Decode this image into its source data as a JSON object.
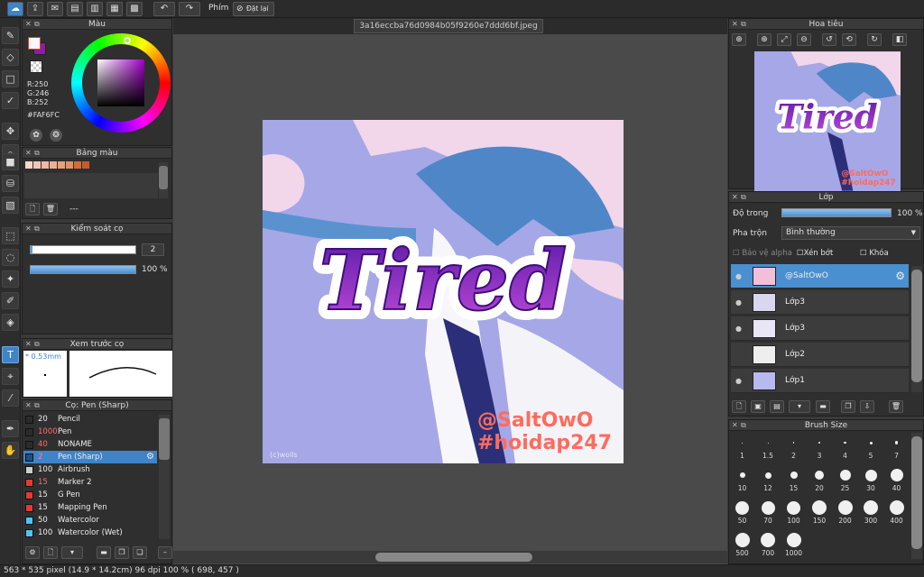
{
  "toolbar": {
    "shortcut_label": "Phím",
    "reset_label": "Đặt lại"
  },
  "document": {
    "tab_title": "3a16eccba76d0984b05f9260e7ddd6bf.jpeg"
  },
  "color_panel": {
    "title": "Màu",
    "r": "R:250",
    "g": "G:246",
    "b": "B:252",
    "hex": "#FAF6FC",
    "main_color": "#fff6fc",
    "sub_color": "#8b1fa0"
  },
  "palette_panel": {
    "title": "Bảng màu",
    "swatches": [
      "#f6d7c8",
      "#f2c7b2",
      "#efb9a2",
      "#f0b091",
      "#e9a07c",
      "#e58f66",
      "#d66a3a",
      "#c95a2e"
    ],
    "name": "---"
  },
  "brush_control": {
    "title": "Kiểm soát cọ",
    "size_value": "2",
    "opacity_value": "100 %",
    "size_fraction": 0.02,
    "opacity_fraction": 1.0
  },
  "brush_preview": {
    "title": "Xem trước cọ",
    "size": "* 0.53mm"
  },
  "brush_list": {
    "title": "Cọ: Pen (Sharp)",
    "items": [
      {
        "num": "20",
        "name": "Pencil",
        "color": "#2b2b2b",
        "num_color": "#eeeeee"
      },
      {
        "num": "1000",
        "name": "Pen",
        "color": "#2b2b2b",
        "num_color": "#ff6b6b"
      },
      {
        "num": "40",
        "name": "NONAME",
        "color": "#2b2b2b",
        "num_color": "#ff6b6b"
      },
      {
        "num": "2",
        "name": "Pen (Sharp)",
        "color": "#1d4f8a",
        "num_color": "#ff8080"
      },
      {
        "num": "100",
        "name": "Airbrush",
        "color": "#cccccc",
        "num_color": "#eeeeee"
      },
      {
        "num": "15",
        "name": "Marker 2",
        "color": "#e53935",
        "num_color": "#ff6b6b"
      },
      {
        "num": "15",
        "name": "G Pen",
        "color": "#e53935",
        "num_color": "#eeeeee"
      },
      {
        "num": "15",
        "name": "Mapping Pen",
        "color": "#e53935",
        "num_color": "#eeeeee"
      },
      {
        "num": "50",
        "name": "Watercolor",
        "color": "#4fc3f7",
        "num_color": "#eeeeee"
      },
      {
        "num": "100",
        "name": "Watercolor (Wet)",
        "color": "#4fc3f7",
        "num_color": "#eeeeee"
      }
    ]
  },
  "artwork": {
    "title_text": "Tired",
    "watermark1": "@SaltOwO",
    "watermark2": "#hoidap247",
    "credit": "(c)wolls"
  },
  "navigator": {
    "title": "Hoa tiêu",
    "title_text": "Tired",
    "watermark1": "@SaltOwO",
    "watermark2": "#hoidap247"
  },
  "layers_panel": {
    "title": "Lớp",
    "opacity_label": "Độ trong",
    "opacity_value": "100 %",
    "opacity_fraction": 1.0,
    "blend_label": "Pha trộn",
    "blend_value": "Bình thường",
    "protect_alpha": "Bảo vệ alpha",
    "clipping": "Xén bớt",
    "lock": "Khóa",
    "layers": [
      {
        "name": "@SaltOwO",
        "selected": true
      },
      {
        "name": "Lớp3"
      },
      {
        "name": "Lớp3"
      },
      {
        "name": "Lớp2"
      },
      {
        "name": "Lớp1"
      }
    ]
  },
  "brush_size": {
    "title": "Brush Size",
    "sizes": [
      "1",
      "1.5",
      "2",
      "3",
      "4",
      "5",
      "7",
      "10",
      "12",
      "15",
      "20",
      "25",
      "30",
      "40",
      "50",
      "70",
      "100",
      "150",
      "200",
      "300",
      "400",
      "500",
      "700",
      "1000"
    ]
  },
  "status": {
    "text": "563 * 535 pixel   (14.9 * 14.2cm)   96 dpi   100 %   ( 698, 457 )"
  }
}
